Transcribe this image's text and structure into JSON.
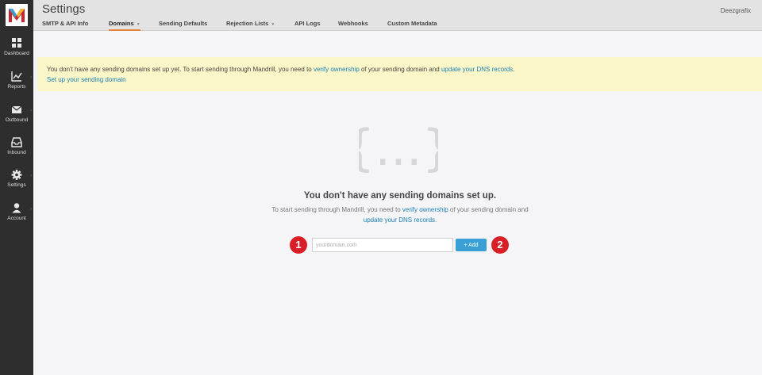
{
  "app": {
    "logo_letter": "M"
  },
  "sidebar": {
    "items": [
      {
        "label": "Dashboard",
        "icon": "grid-icon",
        "has_submenu": false
      },
      {
        "label": "Reports",
        "icon": "chart-icon",
        "has_submenu": true
      },
      {
        "label": "Outbound",
        "icon": "envelope-icon",
        "has_submenu": true
      },
      {
        "label": "Inbound",
        "icon": "inbox-icon",
        "has_submenu": false
      },
      {
        "label": "Settings",
        "icon": "gear-icon",
        "has_submenu": true
      },
      {
        "label": "Account",
        "icon": "user-icon",
        "has_submenu": true
      }
    ]
  },
  "header": {
    "title": "Settings",
    "user": "Deezgrafix",
    "tabs": [
      {
        "label": "SMTP & API Info",
        "active": false,
        "caret": false
      },
      {
        "label": "Domains",
        "active": true,
        "caret": true
      },
      {
        "label": "Sending Defaults",
        "active": false,
        "caret": false
      },
      {
        "label": "Rejection Lists",
        "active": false,
        "caret": true
      },
      {
        "label": "API Logs",
        "active": false,
        "caret": false
      },
      {
        "label": "Webhooks",
        "active": false,
        "caret": false
      },
      {
        "label": "Custom Metadata",
        "active": false,
        "caret": false
      }
    ]
  },
  "alert": {
    "text_before": "You don't have any sending domains set up yet. To start sending through Mandrill, you need to ",
    "link_verify": "verify ownership",
    "text_middle": " of your sending domain and ",
    "link_dns": "update your DNS records",
    "text_end": ".",
    "link_setup": "Set up your sending domain"
  },
  "empty_state": {
    "illustration_text": "{...}",
    "title": "You don't have any sending domains set up.",
    "line1_before": "To start sending through Mandrill, you need to ",
    "link_verify": "verify ownership",
    "line1_after": " of your sending domain and",
    "link_dns": "update your DNS records",
    "line2_after": "."
  },
  "form": {
    "domain_placeholder": "yourdomain.com",
    "domain_value": "",
    "add_label": "+ Add"
  },
  "annotations": {
    "badge1": "1",
    "badge2": "2",
    "badge_color": "#d81f26"
  },
  "colors": {
    "accent": "#e8823a",
    "link": "#1a7fb5",
    "button": "#3a9fd4",
    "sidebar": "#2e2e2e",
    "alert_bg": "#fbf7c8"
  }
}
